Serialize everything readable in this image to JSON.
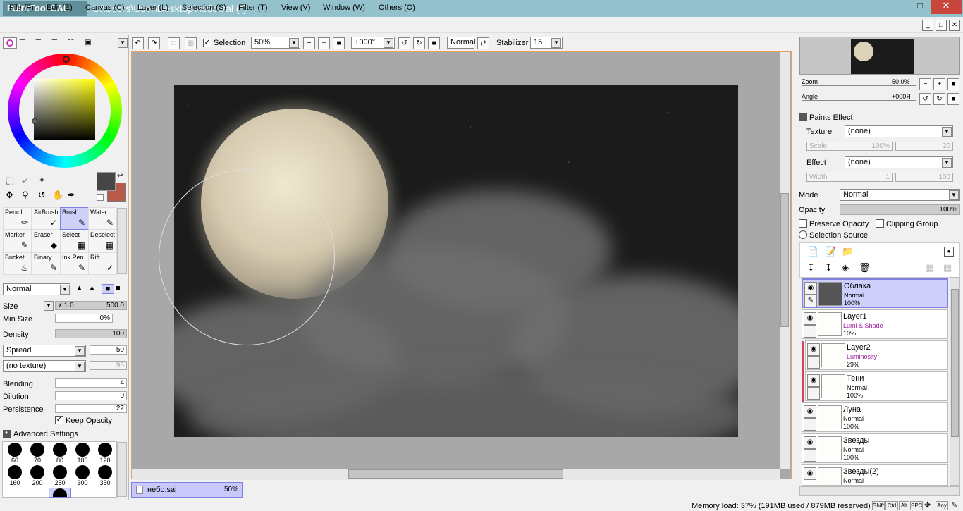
{
  "window": {
    "app_name": "PaintTool SAI",
    "title": "C:\\Users\\User\\Desktop\\небо.sai (*)"
  },
  "menu": [
    "File (F)",
    "Edit (E)",
    "Canvas (C)",
    "Layer (L)",
    "Selection (S)",
    "Filter (T)",
    "View (V)",
    "Window (W)",
    "Others (O)"
  ],
  "toolbar": {
    "selection_label": "Selection",
    "zoom": "50%",
    "angle": "+000°",
    "blend": "Normal",
    "stabilizer_label": "Stabilizer",
    "stabilizer": "15"
  },
  "tools": [
    {
      "label": "Pencil"
    },
    {
      "label": "AirBrush"
    },
    {
      "label": "Brush",
      "active": true
    },
    {
      "label": "Water"
    },
    {
      "label": "Marker"
    },
    {
      "label": "Eraser"
    },
    {
      "label": "Select"
    },
    {
      "label": "Deselect"
    },
    {
      "label": "Bucket"
    },
    {
      "label": "Binary"
    },
    {
      "label": "Ink Pen"
    },
    {
      "label": "Rift"
    }
  ],
  "brush": {
    "mode": "Normal",
    "size_label": "Size",
    "size_mult": "x 1.0",
    "size": "500.0",
    "min_size_label": "Min Size",
    "min_size": "0%",
    "density_label": "Density",
    "density": "100",
    "spread": "Spread",
    "spread_value": "50",
    "texture": "(no texture)",
    "texture_value": "95",
    "blending_label": "Blending",
    "blending": "4",
    "dilution_label": "Dilution",
    "dilution": "0",
    "persistence_label": "Persistence",
    "persistence": "22",
    "keep_opacity": "Keep Opacity",
    "advanced": "Advanced Settings"
  },
  "brush_sizes": [
    "60",
    "70",
    "80",
    "100",
    "120",
    "160",
    "200",
    "250",
    "300",
    "350"
  ],
  "colors": {
    "primary": "#464646",
    "secondary": "#b85a4a",
    "accent": "#8080e0"
  },
  "navigator": {
    "zoom_label": "Zoom",
    "zoom": "50.0%",
    "angle_label": "Angle",
    "angle": "+000Я"
  },
  "paints_effect": {
    "title": "Paints Effect",
    "texture_label": "Texture",
    "texture": "(none)",
    "scale_label": "Scale",
    "scale": "100%",
    "scale_val": "20",
    "effect_label": "Effect",
    "effect": "(none)",
    "width_label": "Width",
    "width": "1",
    "width_val": "100"
  },
  "layer_props": {
    "mode_label": "Mode",
    "mode": "Normal",
    "opacity_label": "Opacity",
    "opacity": "100%",
    "preserve": "Preserve Opacity",
    "clipping": "Clipping Group",
    "selection_source": "Selection Source"
  },
  "layers": [
    {
      "name": "Облака",
      "mode": "Normal",
      "opacity": "100%",
      "selected": true
    },
    {
      "name": "Layer1",
      "mode": "Lumi & Shade",
      "opacity": "10%"
    },
    {
      "name": "Layer2",
      "mode": "Luminosity",
      "opacity": "29%",
      "clipped": true
    },
    {
      "name": "Тени",
      "mode": "Normal",
      "opacity": "100%",
      "clipped": true
    },
    {
      "name": "Луна",
      "mode": "Normal",
      "opacity": "100%"
    },
    {
      "name": "Звезды",
      "mode": "Normal",
      "opacity": "100%"
    },
    {
      "name": "Звезды(2)",
      "mode": "Normal",
      "opacity": ""
    }
  ],
  "tab": {
    "name": "небо.sai",
    "zoom": "50%"
  },
  "status": {
    "memory": "Memory load: 37% (191MB used / 879MB reserved)",
    "keys": [
      "Shift",
      "Ctrl",
      "Alt",
      "SPC",
      "Any"
    ]
  }
}
